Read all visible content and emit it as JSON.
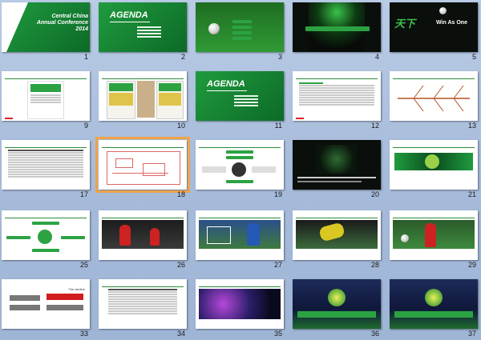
{
  "slides": [
    {
      "num": "1",
      "style": "green",
      "title": "Central China Annual Conference 2014"
    },
    {
      "num": "2",
      "style": "green",
      "title": "AGENDA"
    },
    {
      "num": "3",
      "style": "field",
      "title": ""
    },
    {
      "num": "4",
      "style": "dark",
      "title": ""
    },
    {
      "num": "5",
      "style": "dark",
      "title": "Win As One"
    },
    {
      "num": "9",
      "style": "white",
      "title": ""
    },
    {
      "num": "10",
      "style": "white",
      "title": ""
    },
    {
      "num": "11",
      "style": "green",
      "title": "AGENDA"
    },
    {
      "num": "12",
      "style": "white",
      "title": ""
    },
    {
      "num": "13",
      "style": "white",
      "title": ""
    },
    {
      "num": "17",
      "style": "white",
      "title": ""
    },
    {
      "num": "18",
      "style": "white",
      "title": ""
    },
    {
      "num": "19",
      "style": "white",
      "title": ""
    },
    {
      "num": "20",
      "style": "dark",
      "title": ""
    },
    {
      "num": "21",
      "style": "white",
      "title": ""
    },
    {
      "num": "25",
      "style": "white",
      "title": ""
    },
    {
      "num": "26",
      "style": "white",
      "title": ""
    },
    {
      "num": "27",
      "style": "white",
      "title": ""
    },
    {
      "num": "28",
      "style": "white",
      "title": ""
    },
    {
      "num": "29",
      "style": "white",
      "title": ""
    },
    {
      "num": "33",
      "style": "white",
      "title": "The decline"
    },
    {
      "num": "34",
      "style": "white",
      "title": ""
    },
    {
      "num": "35",
      "style": "white",
      "title": ""
    },
    {
      "num": "36",
      "style": "dark",
      "title": ""
    },
    {
      "num": "37",
      "style": "dark",
      "title": ""
    }
  ],
  "selected_slide": "18",
  "colors": {
    "accent_green": "#1f9b3e",
    "selection": "#f0a34a",
    "background": "#a7bcdb"
  }
}
